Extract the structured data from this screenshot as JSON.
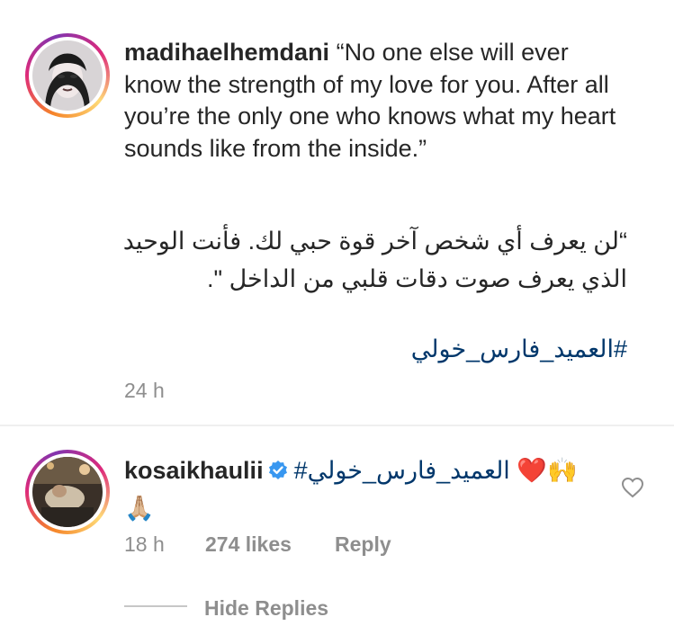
{
  "post": {
    "username": "madihaelhemdani",
    "caption_en": " “No one else will ever know the strength of my love for you. After all you’re the only one who knows what my heart sounds like from the inside.”",
    "caption_ar_line1": "“لن يعرف أي شخص آخر قوة حبي لك. فأنت الوحيد",
    "caption_ar_line2": "الذي يعرف صوت دقات قلبي من الداخل \".",
    "hashtag": "#العميد_فارس_خولي",
    "time": "24 h"
  },
  "comment": {
    "username": "kosaikhaulii",
    "hashtag": "العميد_فارس_خولي#",
    "emoji_line1": "❤️🙌",
    "emoji_line2": "🙏🏼",
    "time": "18 h",
    "likes": "274 likes",
    "reply_label": "Reply",
    "hide_replies_label": "Hide Replies"
  },
  "colors": {
    "text": "#262626",
    "muted": "#8e8e8e",
    "hashtag": "#00376b",
    "verified": "#3897f0",
    "divider": "#efefef"
  },
  "icons": {
    "verified": "verified-badge-icon",
    "like": "heart-outline-icon"
  }
}
